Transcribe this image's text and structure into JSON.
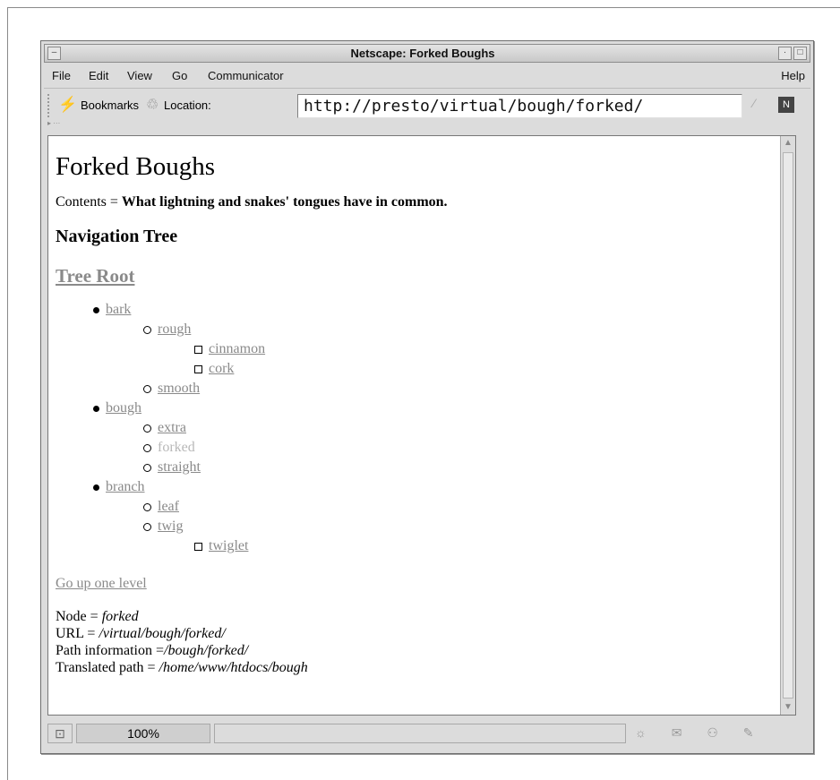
{
  "window": {
    "title": "Netscape: Forked Boughs"
  },
  "menubar": {
    "items": [
      "File",
      "Edit",
      "View",
      "Go",
      "Communicator"
    ],
    "help": "Help"
  },
  "toolbar": {
    "bookmarks_label": "Bookmarks",
    "location_label": "Location:",
    "url": "http://presto/virtual/bough/forked/"
  },
  "page": {
    "heading": "Forked Boughs",
    "contents_prefix": "Contents = ",
    "contents_text": "What lightning and snakes' tongues have in common.",
    "nav_heading": "Navigation Tree",
    "tree_root": "Tree Root",
    "tree": [
      {
        "label": "bark",
        "children": [
          {
            "label": "rough",
            "children": [
              {
                "label": "cinnamon"
              },
              {
                "label": "cork"
              }
            ]
          },
          {
            "label": "smooth"
          }
        ]
      },
      {
        "label": "bough",
        "children": [
          {
            "label": "extra"
          },
          {
            "label": "forked",
            "current": true
          },
          {
            "label": "straight"
          }
        ]
      },
      {
        "label": "branch",
        "children": [
          {
            "label": "leaf"
          },
          {
            "label": "twig",
            "children": [
              {
                "label": "twiglet"
              }
            ]
          }
        ]
      }
    ],
    "go_up": "Go up one level",
    "info": {
      "node_label": "Node = ",
      "node_value": "forked",
      "url_label": "URL = ",
      "url_value": "/virtual/bough/forked/",
      "path_label": "Path information =",
      "path_value": "/bough/forked/",
      "translated_label": "Translated path = ",
      "translated_value": "/home/www/htdocs/bough"
    }
  },
  "status": {
    "progress": "100%"
  },
  "colors": {
    "link": "#8a8a8a",
    "visited": "#b8b8b8",
    "chrome": "#dcdcdc"
  }
}
